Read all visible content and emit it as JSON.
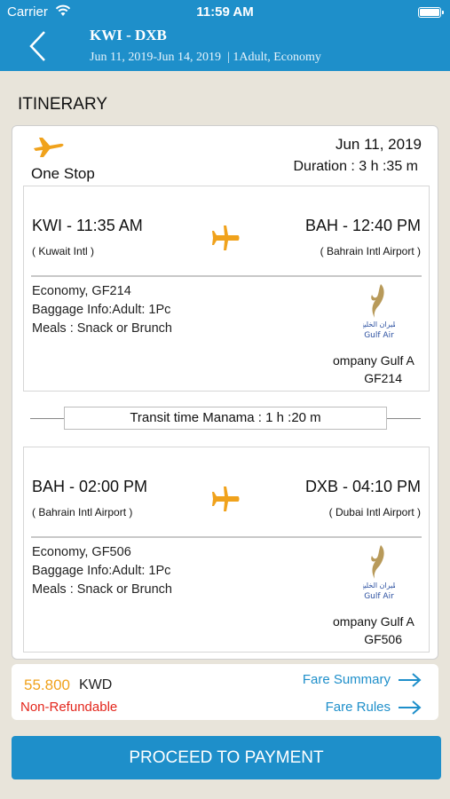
{
  "status_bar": {
    "carrier": "Carrier",
    "time": "11:59 AM"
  },
  "header": {
    "route": "KWI - DXB",
    "dates": "Jun 11, 2019-Jun 14, 2019",
    "passengers": "| 1Adult, Economy"
  },
  "section_title": "ITINERARY",
  "itinerary": {
    "stops": "One Stop",
    "date": "Jun 11, 2019",
    "duration": "Duration : 3 h :35 m",
    "segments": [
      {
        "departure": "KWI - 11:35 AM",
        "departure_airport": "( Kuwait Intl )",
        "arrival": "BAH - 12:40 PM",
        "arrival_airport": "( Bahrain Intl Airport )",
        "class_flight": "Economy, GF214",
        "baggage": "Baggage Info:Adult: 1Pc",
        "meals": "Meals : Snack or Brunch",
        "airline": "ompany Gulf A",
        "flight_no": "GF214"
      },
      {
        "departure": "BAH - 02:00 PM",
        "departure_airport": "( Bahrain Intl Airport )",
        "arrival": "DXB - 04:10 PM",
        "arrival_airport": "( Dubai Intl Airport )",
        "class_flight": "Economy, GF506",
        "baggage": "Baggage Info:Adult: 1Pc",
        "meals": "Meals : Snack or Brunch",
        "airline": "ompany Gulf A",
        "flight_no": "GF506"
      }
    ],
    "transit": "Transit time Manama : 1 h :20 m"
  },
  "fare": {
    "price": "55.800",
    "currency": "KWD",
    "refund_status": "Non-Refundable",
    "fare_summary_label": "Fare Summary",
    "fare_rules_label": "Fare Rules"
  },
  "proceed_label": "PROCEED TO PAYMENT",
  "colors": {
    "header_blue": "#1e8fca",
    "plane_orange": "#f0a21c",
    "refund_red": "#e3261c",
    "background": "#e8e4da"
  },
  "icons": {
    "back": "chevron-left-icon",
    "plane": "airplane-icon",
    "arrow": "arrow-right-icon",
    "airline_logo": "gulf-air-logo"
  }
}
